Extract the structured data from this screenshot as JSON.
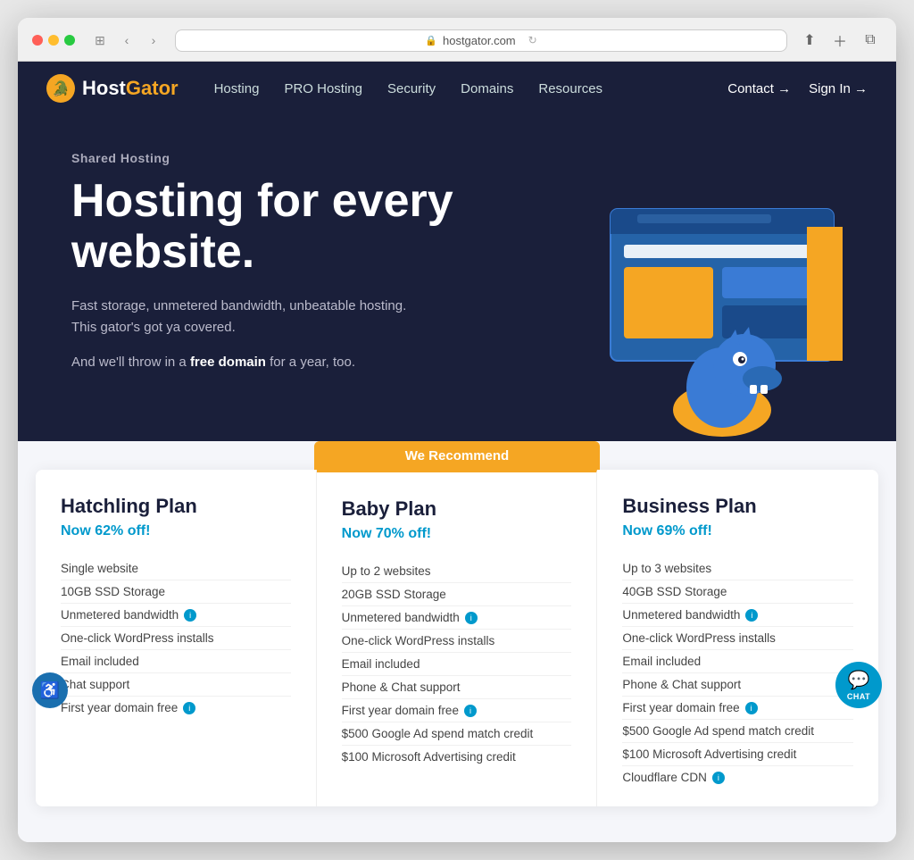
{
  "browser": {
    "url": "hostgator.com",
    "back_arrow": "‹",
    "forward_arrow": "›"
  },
  "navbar": {
    "logo_text_host": "Host",
    "logo_text_gator": "Gator",
    "nav_links": [
      {
        "label": "Hosting",
        "id": "hosting"
      },
      {
        "label": "PRO Hosting",
        "id": "pro-hosting"
      },
      {
        "label": "Security",
        "id": "security"
      },
      {
        "label": "Domains",
        "id": "domains"
      },
      {
        "label": "Resources",
        "id": "resources"
      }
    ],
    "contact_label": "Contact →",
    "signin_label": "Sign In →"
  },
  "hero": {
    "subtitle": "Shared Hosting",
    "title": "Hosting for every website.",
    "description": "Fast storage, unmetered bandwidth, unbeatable hosting. This gator's got ya covered.",
    "free_domain_prefix": "And we'll throw in a ",
    "free_domain_bold": "free domain",
    "free_domain_suffix": " for a year, too."
  },
  "recommend_badge": "We Recommend",
  "plans": [
    {
      "id": "hatchling",
      "name": "Hatchling Plan",
      "discount": "Now 62% off!",
      "featured": false,
      "features": [
        {
          "text": "Single website",
          "has_info": false
        },
        {
          "text": "10GB SSD Storage",
          "has_info": false
        },
        {
          "text": "Unmetered bandwidth",
          "has_info": true
        },
        {
          "text": "One-click WordPress installs",
          "has_info": false
        },
        {
          "text": "Email included",
          "has_info": false
        },
        {
          "text": "Chat support",
          "has_info": false
        },
        {
          "text": "First year domain free",
          "has_info": true
        }
      ]
    },
    {
      "id": "baby",
      "name": "Baby Plan",
      "discount": "Now 70% off!",
      "featured": true,
      "features": [
        {
          "text": "Up to 2 websites",
          "has_info": false
        },
        {
          "text": "20GB SSD Storage",
          "has_info": false
        },
        {
          "text": "Unmetered bandwidth",
          "has_info": true
        },
        {
          "text": "One-click WordPress installs",
          "has_info": false
        },
        {
          "text": "Email included",
          "has_info": false
        },
        {
          "text": "Phone & Chat support",
          "has_info": false
        },
        {
          "text": "First year domain free",
          "has_info": true
        },
        {
          "text": "$500 Google Ad spend match credit",
          "has_info": false
        },
        {
          "text": "$100 Microsoft Advertising credit",
          "has_info": false
        }
      ]
    },
    {
      "id": "business",
      "name": "Business Plan",
      "discount": "Now 69% off!",
      "featured": false,
      "features": [
        {
          "text": "Up to 3 websites",
          "has_info": false
        },
        {
          "text": "40GB SSD Storage",
          "has_info": false
        },
        {
          "text": "Unmetered bandwidth",
          "has_info": true
        },
        {
          "text": "One-click WordPress installs",
          "has_info": false
        },
        {
          "text": "Email included",
          "has_info": false
        },
        {
          "text": "Phone & Chat support",
          "has_info": false
        },
        {
          "text": "First year domain free",
          "has_info": true
        },
        {
          "text": "$500 Google Ad spend match credit",
          "has_info": false
        },
        {
          "text": "$100 Microsoft Advertising credit",
          "has_info": false
        },
        {
          "text": "Cloudflare CDN",
          "has_info": true
        }
      ]
    }
  ],
  "accessibility_label": "♿",
  "chat_label": "CHAT"
}
